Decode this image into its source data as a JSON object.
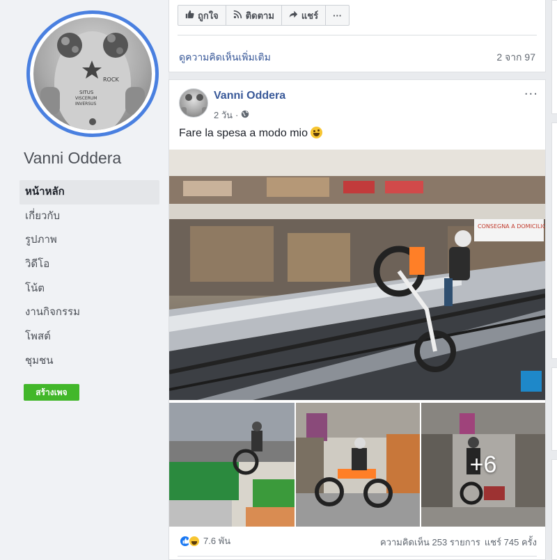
{
  "sidebar": {
    "page_name": "Vanni Oddera",
    "nav_items": [
      {
        "label": "หน้าหลัก",
        "active": true
      },
      {
        "label": "เกี่ยวกับ",
        "active": false
      },
      {
        "label": "รูปภาพ",
        "active": false
      },
      {
        "label": "วิดีโอ",
        "active": false
      },
      {
        "label": "โน้ต",
        "active": false
      },
      {
        "label": "งานกิจกรรม",
        "active": false
      },
      {
        "label": "โพสต์",
        "active": false
      },
      {
        "label": "ชุมชน",
        "active": false
      }
    ],
    "create_page_label": "สร้างเพจ"
  },
  "previous_post": {
    "like_label": "ถูกใจ",
    "follow_label": "ติดตาม",
    "share_label": "แชร์",
    "more_label": "···",
    "view_more_comments": "ดูความคิดเห็นเพิ่มเติม",
    "comment_count": "2 จาก 97"
  },
  "post": {
    "author": "Vanni Oddera",
    "time": "2 วัน",
    "privacy_icon": "globe-icon",
    "text": "Fare la spesa a modo mio",
    "more_label": "···",
    "extra_photos": "+6",
    "sign_text": "CONSEGNA A DOMICILIO DELLA SPESA",
    "reaction_count": "7.6 พัน",
    "comments": "ความคิดเห็น 253 รายการ",
    "shares": "แชร์ 745 ครั้ง"
  },
  "colors": {
    "link_blue": "#385898",
    "avatar_ring": "#4a80e0",
    "create_green": "#42b72a",
    "like_blue": "#1877f2"
  }
}
